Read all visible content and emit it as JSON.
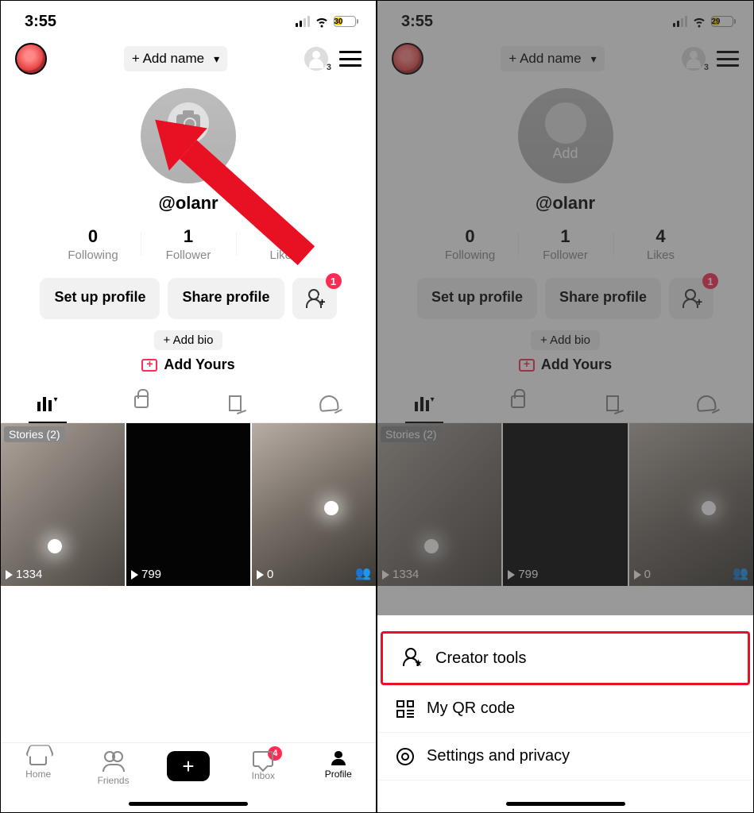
{
  "left": {
    "statusbar": {
      "time": "3:55",
      "battery": "30"
    },
    "header": {
      "add_name": "+ Add name",
      "mini_count": "3"
    },
    "profile": {
      "add_label": "Add",
      "username": "@olanr"
    },
    "stats": [
      {
        "num": "0",
        "lbl": "Following"
      },
      {
        "num": "1",
        "lbl": "Follower"
      },
      {
        "num": "4",
        "lbl": "Likes"
      }
    ],
    "actions": {
      "setup": "Set up profile",
      "share": "Share profile",
      "badge": "1"
    },
    "bio": {
      "add_bio": "+ Add bio",
      "add_yours": "Add Yours"
    },
    "grid": {
      "stories_tag": "Stories (2)",
      "cells": [
        {
          "views": "1334"
        },
        {
          "views": "799"
        },
        {
          "views": "0"
        }
      ]
    },
    "nav": {
      "home": "Home",
      "friends": "Friends",
      "inbox": "Inbox",
      "inbox_badge": "4",
      "profile": "Profile"
    }
  },
  "right": {
    "statusbar": {
      "time": "3:55",
      "battery": "29"
    },
    "menu": [
      {
        "label": "Creator tools"
      },
      {
        "label": "My QR code"
      },
      {
        "label": "Settings and privacy"
      }
    ]
  }
}
